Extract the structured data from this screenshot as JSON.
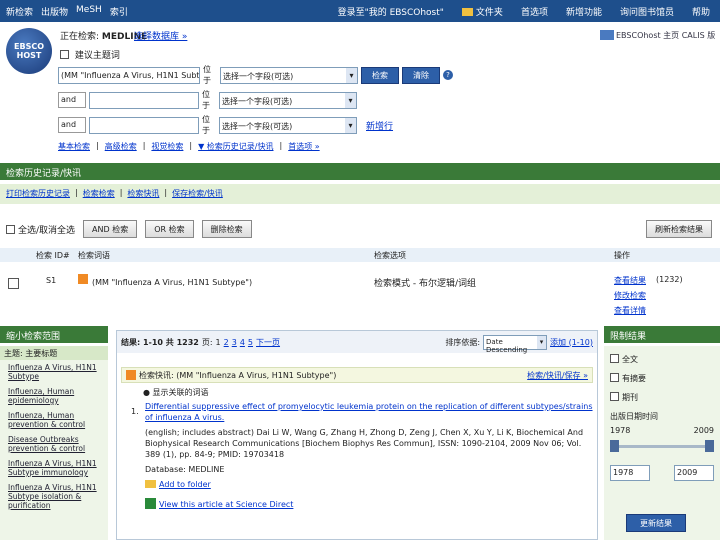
{
  "topbar": {
    "left": [
      "新检索",
      "出版物",
      "MeSH",
      "索引"
    ],
    "folder": "文件夹",
    "right": [
      "登录至\"我的 EBSCOhost\"",
      "首选项",
      "新增功能",
      "询问图书馆员",
      "帮助"
    ]
  },
  "logo": "EBSCO HOST",
  "search": {
    "searching_label": "正在检索:",
    "db": "MEDLINE",
    "choose_db": "选择数据库 »",
    "suggest": "建议主题词",
    "promo": "EBSCOhost 主页 CALIS 版",
    "rows": [
      {
        "bool": "",
        "term": "(MM \"Influenza A Virus, H1N1 Subtype\")",
        "in": "位于",
        "field": "选择一个字段(可选)"
      },
      {
        "bool": "and",
        "term": "",
        "in": "位于",
        "field": "选择一个字段(可选)"
      },
      {
        "bool": "and",
        "term": "",
        "in": "位于",
        "field": "选择一个字段(可选)"
      }
    ],
    "search_btn": "检索",
    "clear_btn": "清除",
    "add_row": "新增行",
    "modes": [
      "基本检索",
      "高级检索",
      "视觉检索",
      "▼ 检索历史记录/快讯",
      "首选项 »"
    ]
  },
  "history": {
    "title": "检索历史记录/快讯",
    "links": [
      "打印检索历史记录",
      "检索检索",
      "检索快讯",
      "保存检索/快讯"
    ],
    "select_all": "全选/取消全选",
    "buttons": [
      "AND 检索",
      "OR 检索",
      "删除检索"
    ],
    "refresh": "刷新检索结果",
    "headers": [
      "检索 ID#",
      "检索词语",
      "检索选项",
      "操作"
    ],
    "row": {
      "id": "S1",
      "term": "(MM \"Influenza A Virus, H1N1 Subtype\")",
      "option": "检索模式 - 布尔逻辑/词组",
      "actions": [
        "查看结果",
        "修改检索",
        "查看详情"
      ],
      "count": "(1232)"
    }
  },
  "refine": {
    "title": "缩小检索范围",
    "subhead": "主题: 主要标题",
    "items": [
      "Influenza A Virus, H1N1 Subtype",
      "Influenza, Human epidemiology",
      "Influenza, Human prevention & control",
      "Disease Outbreaks prevention & control",
      "Influenza A Virus, H1N1 Subtype immunology",
      "Influenza A Virus, H1N1 Subtype isolation & purification"
    ]
  },
  "results": {
    "range": "结果: 1-10 共 1232",
    "page_label": "页:",
    "pages": [
      "1",
      "2",
      "3",
      "4",
      "5"
    ],
    "next": "下一页",
    "sort_label": "排序依据:",
    "sort_value": "Date Descending",
    "add_label": "添加 (1-10)",
    "alert_text": "检索快讯: (MM \"Influenza A Virus, H1N1 Subtype\")",
    "alert_link": "检索/快讯/保存 »",
    "related": "● 显示关联的词语",
    "item_num": "1.",
    "item_title": "Differential suppressive effect of promyelocytic leukemia protein on the replication of different subtypes/strains of influenza A virus.",
    "item_authors": "(english; includes abstract) Dai Li W, Wang G, Zhang H, Zhong D, Zeng J, Chen X, Xu Y, Li K, Biochemical And Biophysical Research Communications [Biochem Biophys Res Commun], ISSN: 1090-2104, 2009 Nov 06; Vol. 389 (1), pp. 84-9; PMID: 19703418",
    "database": "Database: MEDLINE",
    "add_folder": "Add to folder",
    "science_direct": "View this article at Science Direct"
  },
  "limit": {
    "title": "限制结果",
    "options": [
      "全文",
      "有摘要",
      "期刊"
    ],
    "date_label": "出版日期时间",
    "year_min": "1978",
    "year_max": "2009",
    "update_btn": "更新结果"
  }
}
